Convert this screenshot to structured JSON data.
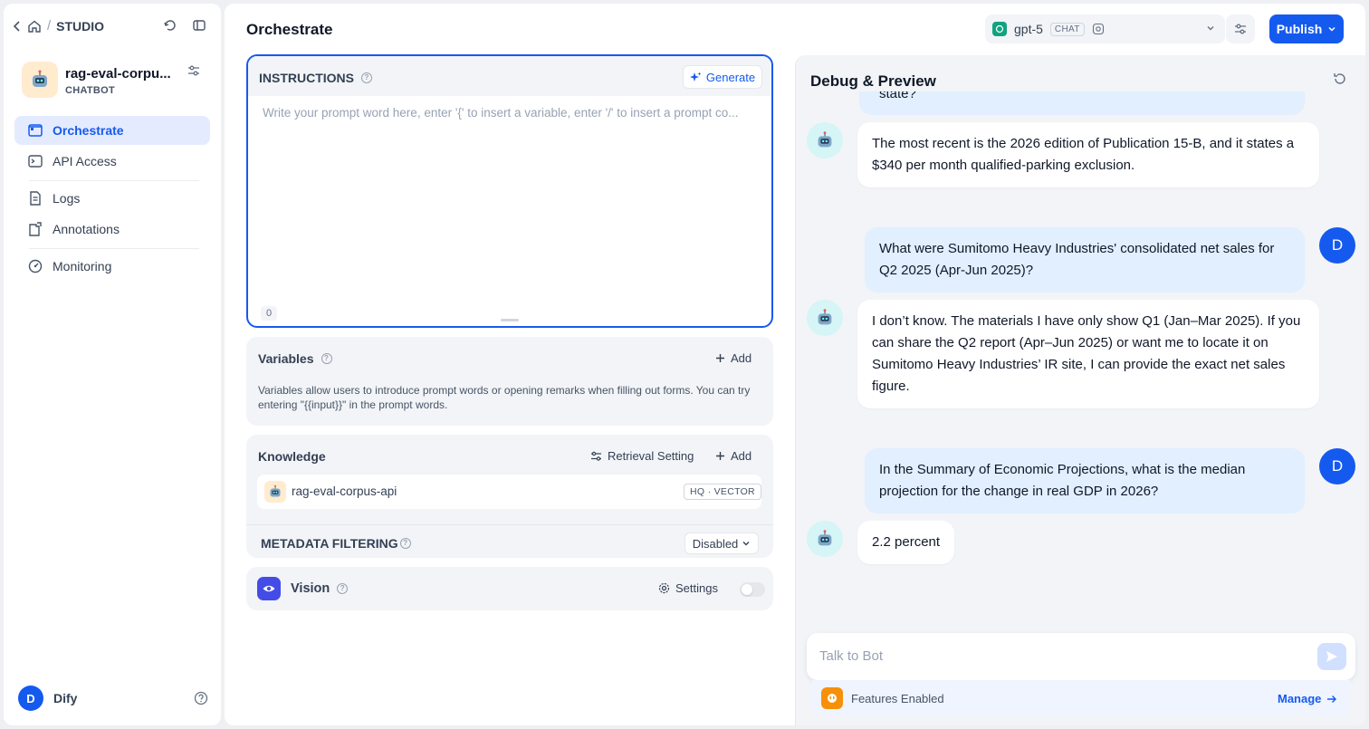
{
  "sidebar": {
    "breadcrumb": "STUDIO",
    "app_name": "rag-eval-corpu...",
    "app_type": "CHATBOT",
    "nav": [
      {
        "label": "Orchestrate",
        "icon": "layout-icon"
      },
      {
        "label": "API Access",
        "icon": "terminal-icon"
      },
      {
        "label": "Logs",
        "icon": "file-list-icon"
      },
      {
        "label": "Annotations",
        "icon": "annotation-icon"
      },
      {
        "label": "Monitoring",
        "icon": "gauge-icon"
      }
    ],
    "user_initial": "D",
    "workspace": "Dify"
  },
  "header": {
    "title": "Orchestrate",
    "model_name": "gpt-5",
    "model_badge": "CHAT",
    "publish_label": "Publish"
  },
  "instructions": {
    "title": "INSTRUCTIONS",
    "generate_label": "Generate",
    "placeholder": "Write your prompt word here, enter '{' to insert a variable, enter '/' to insert a prompt co...",
    "char_count": "0"
  },
  "variables": {
    "title": "Variables",
    "add_label": "Add",
    "description": "Variables allow users to introduce prompt words or opening remarks when filling out forms. You can try entering \"{{input}}\" in the prompt words."
  },
  "knowledge": {
    "title": "Knowledge",
    "retrieval_label": "Retrieval Setting",
    "add_label": "Add",
    "dataset_name": "rag-eval-corpus-api",
    "dataset_badge": "HQ · VECTOR",
    "metadata_title": "METADATA FILTERING",
    "metadata_value": "Disabled"
  },
  "vision": {
    "title": "Vision",
    "settings_label": "Settings"
  },
  "debug": {
    "title": "Debug & Preview",
    "cut_text": "state?",
    "messages": [
      {
        "role": "bot",
        "text": "The most recent is the 2026 edition of Publication 15-B, and it states a $340 per month qualified-parking exclusion."
      },
      {
        "role": "user",
        "text": "What were Sumitomo Heavy Industries' consolidated net sales for Q2 2025 (Apr-Jun 2025)?"
      },
      {
        "role": "bot",
        "text": "I don’t know. The materials I have only show Q1 (Jan–Mar 2025). If you can share the Q2 report (Apr–Jun 2025) or want me to locate it on Sumitomo Heavy Industries’ IR site, I can provide the exact net sales figure."
      },
      {
        "role": "user",
        "text": "In the Summary of Economic Projections, what is the median projection for the change in real GDP in 2026?"
      },
      {
        "role": "bot",
        "text": "2.2 percent"
      }
    ],
    "input_placeholder": "Talk to Bot",
    "features_label": "Features Enabled",
    "manage_label": "Manage"
  }
}
